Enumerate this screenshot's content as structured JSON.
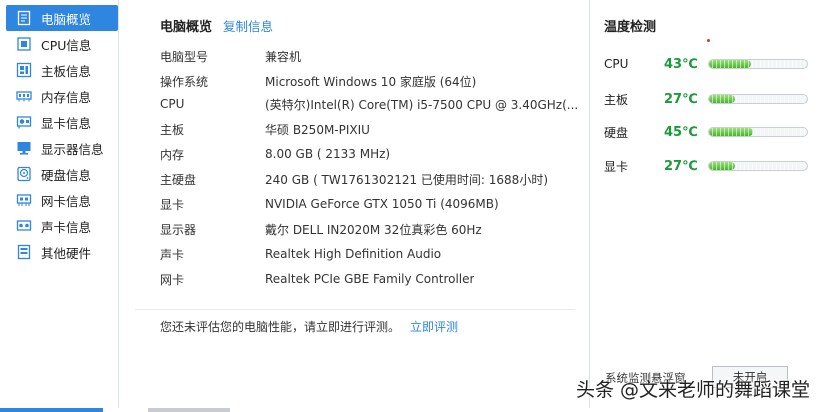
{
  "sidebar": {
    "items": [
      {
        "label": "电脑概览",
        "icon": "overview-doc-icon",
        "active": true
      },
      {
        "label": "CPU信息",
        "icon": "cpu-icon"
      },
      {
        "label": "主板信息",
        "icon": "motherboard-icon"
      },
      {
        "label": "内存信息",
        "icon": "memory-icon"
      },
      {
        "label": "显卡信息",
        "icon": "gpu-icon"
      },
      {
        "label": "显示器信息",
        "icon": "monitor-icon"
      },
      {
        "label": "硬盘信息",
        "icon": "harddisk-icon"
      },
      {
        "label": "网卡信息",
        "icon": "network-card-icon"
      },
      {
        "label": "声卡信息",
        "icon": "sound-card-icon"
      },
      {
        "label": "其他硬件",
        "icon": "other-hardware-icon"
      }
    ]
  },
  "main": {
    "title": "电脑概览",
    "copy_label": "复制信息",
    "rows": [
      {
        "key": "电脑型号",
        "value": "兼容机"
      },
      {
        "key": "操作系统",
        "value": "Microsoft Windows 10 家庭版 (64位)"
      },
      {
        "key": "CPU",
        "value": "(英特尔)Intel(R) Core(TM) i5-7500 CPU @ 3.40GHz(..."
      },
      {
        "key": "主板",
        "value": "华硕 B250M-PIXIU"
      },
      {
        "key": "内存",
        "value": "8.00 GB (   2133 MHz)"
      },
      {
        "key": "主硬盘",
        "value": "240 GB (  TW1761302121 已使用时间: 1688小时)"
      },
      {
        "key": "显卡",
        "value": "NVIDIA GeForce GTX 1050 Ti (4096MB)"
      },
      {
        "key": "显示器",
        "value": "戴尔 DELL IN2020M 32位真彩色 60Hz"
      },
      {
        "key": "声卡",
        "value": "Realtek High Definition Audio"
      },
      {
        "key": "网卡",
        "value": "Realtek PCIe GBE Family Controller"
      }
    ],
    "eval_text": "您还未评估您的电脑性能，请立即进行评测。",
    "eval_link": "立即评测"
  },
  "temperature": {
    "title": "温度检测",
    "items": [
      {
        "name": "CPU",
        "value": "43℃",
        "level": 0.43
      },
      {
        "name": "主板",
        "value": "27℃",
        "level": 0.27
      },
      {
        "name": "硬盘",
        "value": "45℃",
        "level": 0.45
      },
      {
        "name": "显卡",
        "value": "27℃",
        "level": 0.27
      }
    ],
    "monitor_label": "系统监测悬浮窗",
    "monitor_button": "未开启",
    "value_color": "#1a9a3a"
  },
  "watermark": "头条 @文来老师的舞蹈课堂",
  "accent_color": "#2f86e0"
}
